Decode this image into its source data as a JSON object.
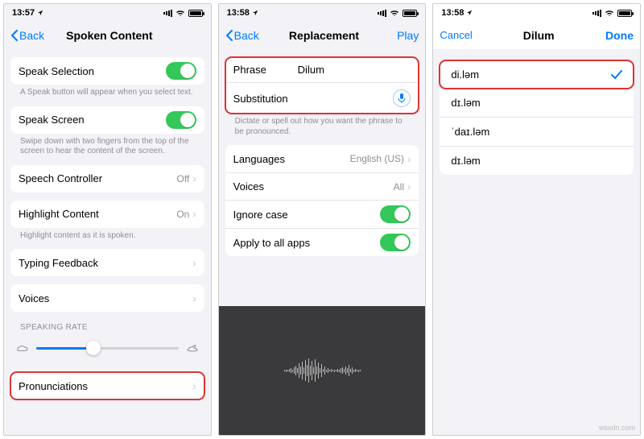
{
  "watermark": "wsxdn.com",
  "phone1": {
    "status": {
      "time": "13:57",
      "loc": "◂"
    },
    "nav": {
      "back": "Back",
      "title": "Spoken Content"
    },
    "rows": {
      "speak_selection": "Speak Selection",
      "speak_selection_footer": "A Speak button will appear when you select text.",
      "speak_screen": "Speak Screen",
      "speak_screen_footer": "Swipe down with two fingers from the top of the screen to hear the content of the screen.",
      "speech_controller": "Speech Controller",
      "speech_controller_val": "Off",
      "highlight_content": "Highlight Content",
      "highlight_content_val": "On",
      "highlight_footer": "Highlight content as it is spoken.",
      "typing_feedback": "Typing Feedback",
      "voices": "Voices",
      "speaking_rate_header": "SPEAKING RATE",
      "pronunciations": "Pronunciations"
    }
  },
  "phone2": {
    "status": {
      "time": "13:58",
      "loc": "◂"
    },
    "nav": {
      "back": "Back",
      "title": "Replacement",
      "action": "Play"
    },
    "form": {
      "phrase_label": "Phrase",
      "phrase_value": "Dilum",
      "sub_label": "Substitution",
      "sub_value": "",
      "footer": "Dictate or spell out how you want the phrase to be pronounced."
    },
    "rows": {
      "languages": "Languages",
      "languages_val": "English (US)",
      "voices": "Voices",
      "voices_val": "All",
      "ignore_case": "Ignore case",
      "apply_all": "Apply to all apps"
    }
  },
  "phone3": {
    "status": {
      "time": "13:58",
      "loc": "◂"
    },
    "nav": {
      "cancel": "Cancel",
      "title": "Dilum",
      "done": "Done"
    },
    "options": [
      "di.ləm",
      "dɪ.ləm",
      "ˈdaɪ.ləm",
      "dɪ.ləm"
    ],
    "selected_index": 0
  }
}
